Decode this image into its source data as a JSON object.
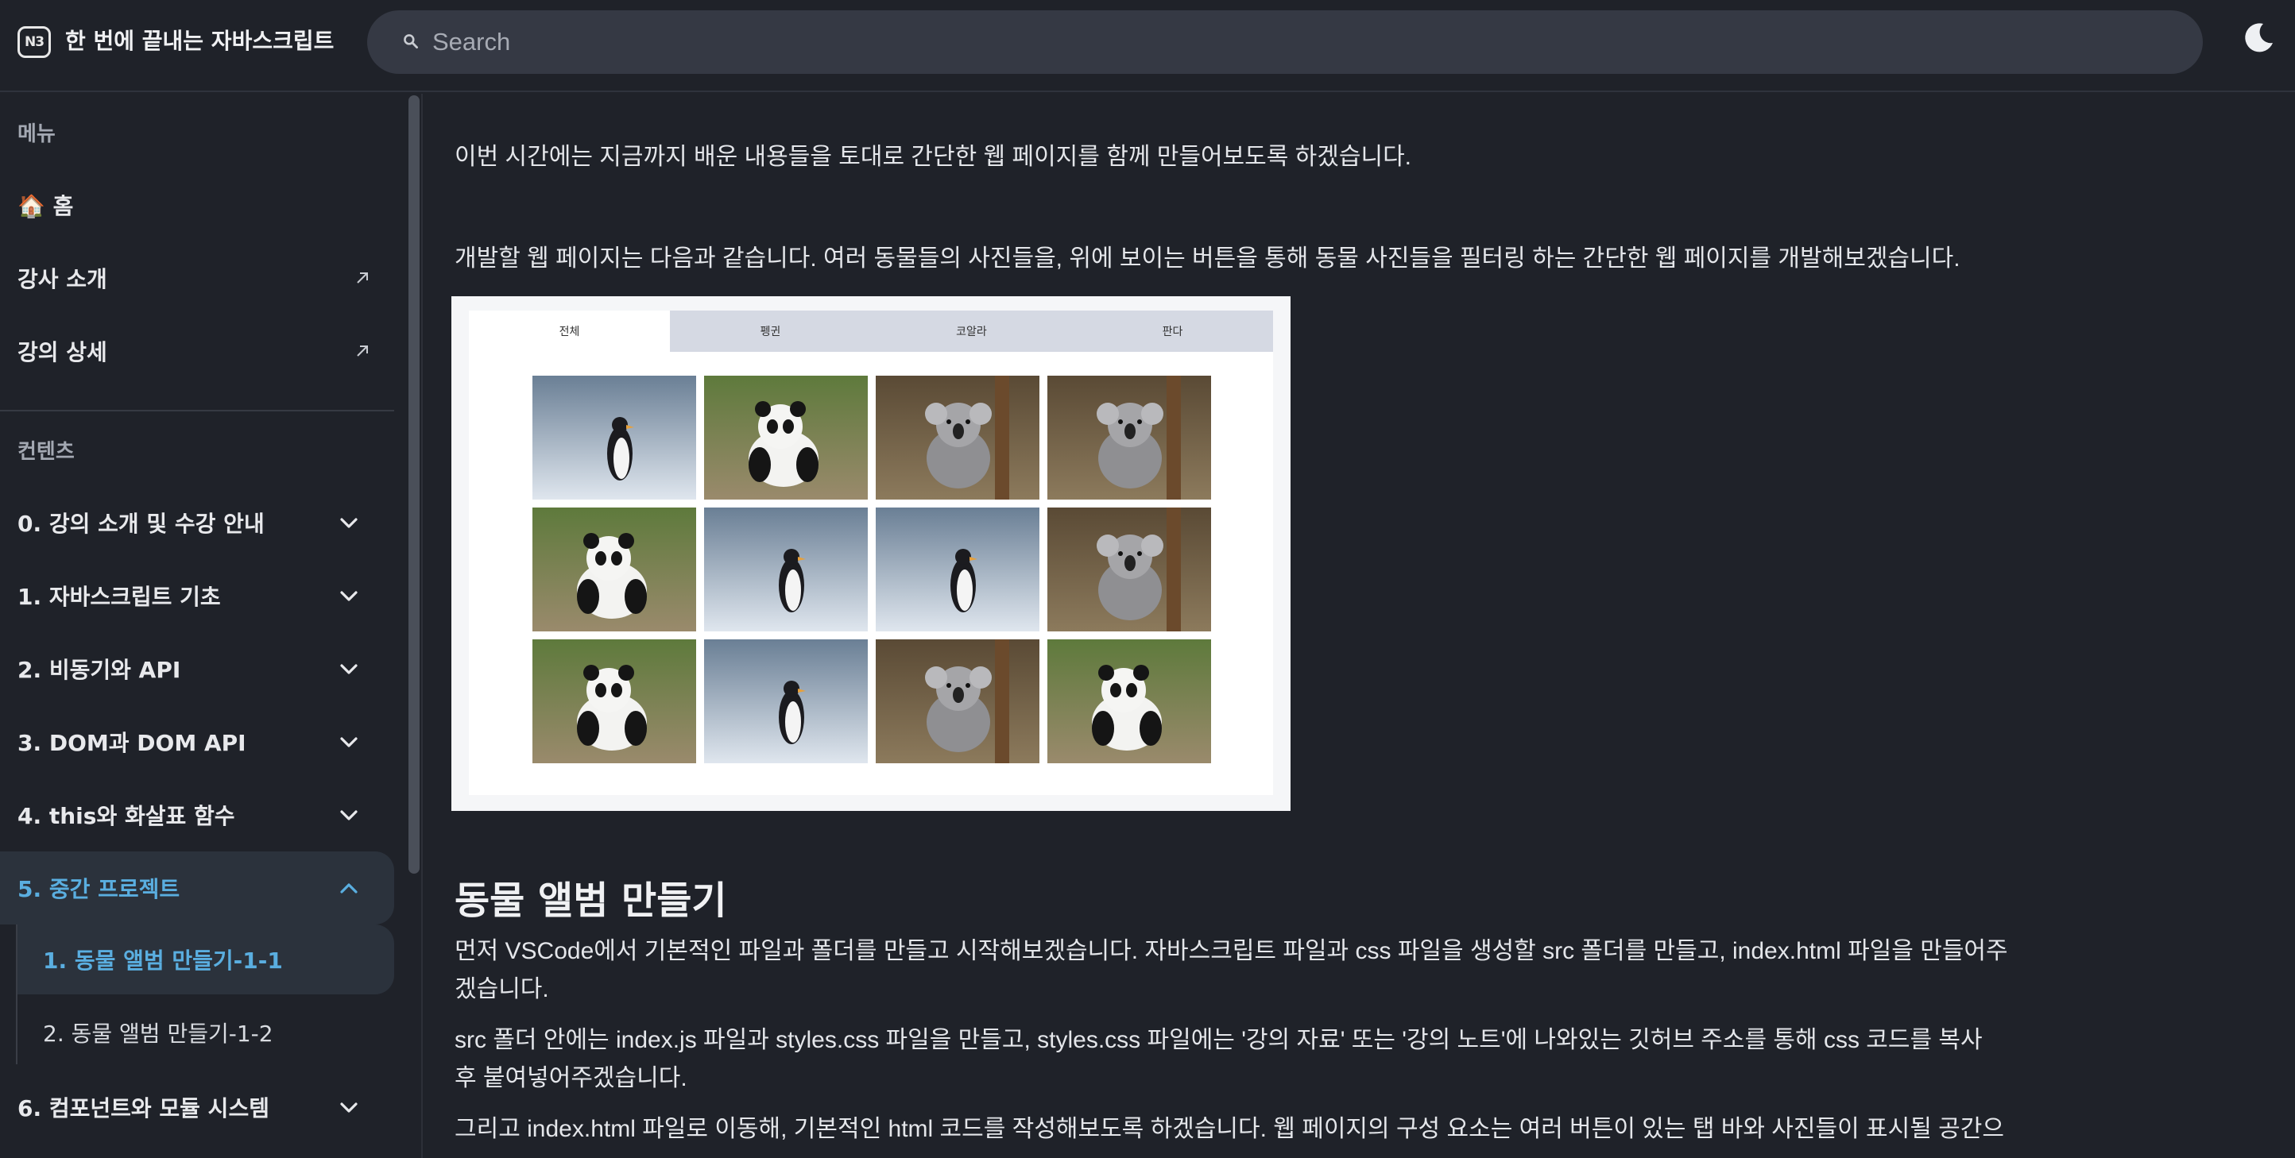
{
  "header": {
    "logo_text": "N3",
    "title": "한 번에 끝내는 자바스크립트",
    "search_placeholder": "Search"
  },
  "sidebar": {
    "menu_label": "메뉴",
    "menu_items": [
      {
        "label": "🏠 홈"
      },
      {
        "label": "강사 소개"
      },
      {
        "label": "강의 상세"
      }
    ],
    "content_label": "컨텐츠",
    "chapters": [
      {
        "label": "0. 강의 소개 및 수강 안내"
      },
      {
        "label": "1. 자바스크립트 기초"
      },
      {
        "label": "2. 비동기와 API"
      },
      {
        "label": "3. DOM과 DOM API"
      },
      {
        "label": "4. this와 화살표 함수"
      },
      {
        "label": "5. 중간 프로젝트"
      },
      {
        "label": "6. 컴포넌트와 모듈 시스템"
      }
    ],
    "sub_items": [
      {
        "label": "1. 동물 앨범 만들기-1-1"
      },
      {
        "label": "2. 동물 앨범 만들기-1-2"
      }
    ]
  },
  "main": {
    "intro": "이번 시간에는 지금까지 배운 내용들을 토대로 간단한 웹 페이지를 함께 만들어보도록 하겠습니다.",
    "desc": "개발할 웹 페이지는 다음과 같습니다. 여러 동물들의 사진들을, 위에 보이는 버튼을 통해 동물 사진들을 필터링 하는 간단한 웹 페이지를 개발해보겠습니다.",
    "demo_tabs": [
      "전체",
      "펭귄",
      "코알라",
      "판다"
    ],
    "demo_photos": [
      "penguin",
      "panda",
      "koala",
      "koala",
      "panda",
      "penguin",
      "penguin",
      "koala",
      "panda",
      "penguin",
      "koala",
      "panda"
    ],
    "heading": "동물 앨범 만들기",
    "p1_line1": "먼저 VSCode에서 기본적인 파일과 폴더를 만들고 시작해보겠습니다. 자바스크립트 파일과 css 파일을 생성할 src 폴더를 만들고, index.html 파일을 만들어주",
    "p1_line2": "겠습니다.",
    "p2_line1": "src 폴더 안에는 index.js 파일과 styles.css 파일을 만들고, styles.css 파일에는 '강의 자료' 또는 '강의 노트'에 나와있는 깃허브 주소를 통해 css 코드를 복사",
    "p2_line2": "후 붙여넣어주겠습니다.",
    "p3_line1": "그리고 index.html 파일로 이동해, 기본적인 html 코드를 작성해보도록 하겠습니다. 웹 페이지의 구성 요소는 여러 버튼이 있는 탭 바와 사진들이 표시될 공간으"
  },
  "colors": {
    "background": "#1f2229",
    "search_bg": "#353944",
    "active_bg": "#2b323c",
    "accent": "#5aaee0"
  }
}
